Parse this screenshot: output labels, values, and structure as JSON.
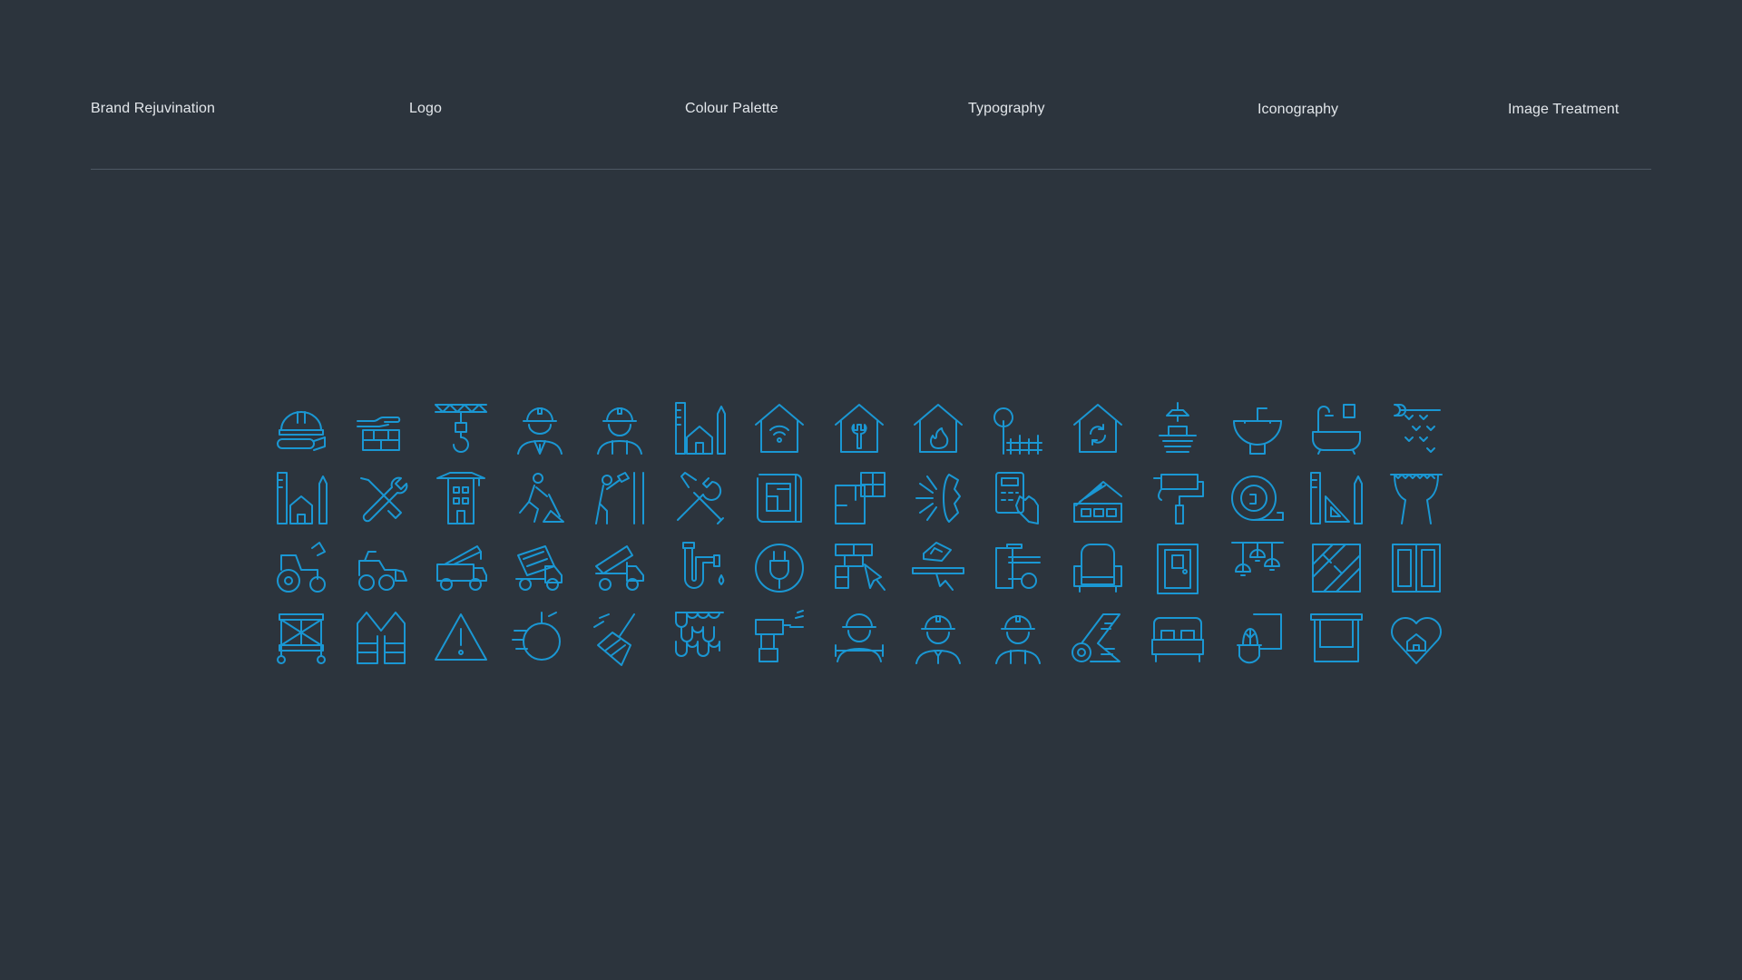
{
  "nav": {
    "items": [
      "Brand Rejuvination",
      "Logo",
      "Colour Palette",
      "Typography",
      "Iconography",
      "Image Treatment"
    ]
  },
  "colors": {
    "background": "#2c343d",
    "nav_text": "#e3e7eb",
    "divider": "#4e5864",
    "icon_stroke": "#1a97d3"
  },
  "icon_rows": [
    [
      "hard-hat-blueprint",
      "bricks-hand",
      "crane-hook",
      "construction-worker",
      "worker-hard-hat",
      "ruler-pencil-house",
      "smart-home-wifi",
      "house-wrench",
      "house-flame",
      "tree-fence",
      "house-refresh",
      "ceiling-lamp-sink",
      "washbasin",
      "bathtub-shower",
      "wallpaper-pattern"
    ],
    [
      "architecture-house-tools",
      "tools-crossed",
      "building-crane",
      "digging-worker",
      "painter-wall",
      "wrench-screwdriver",
      "blueprint-plan",
      "floor-plan-window",
      "light-burst-wall",
      "calculator-hand",
      "paint-swatches",
      "paint-roller",
      "tape-measure",
      "set-square-pencil",
      "curtains-window"
    ],
    [
      "tractor",
      "compact-loader",
      "crane-truck",
      "cement-mixer",
      "dump-truck",
      "pipe-drip",
      "electric-plug",
      "brick-trowel",
      "window-sill",
      "door-lock",
      "armchair",
      "door",
      "pendant-lamps",
      "parquet-floor",
      "wardrobe"
    ],
    [
      "scaffolding",
      "safety-vest",
      "warning-triangle",
      "wrecking-ball",
      "broom-sweep",
      "roof-tiles",
      "cordless-drill",
      "mechanic-wrench",
      "engineer-worker",
      "builder-worker",
      "carpet-roll",
      "double-bed",
      "plant-frame",
      "window-blind",
      "heart-house"
    ]
  ]
}
